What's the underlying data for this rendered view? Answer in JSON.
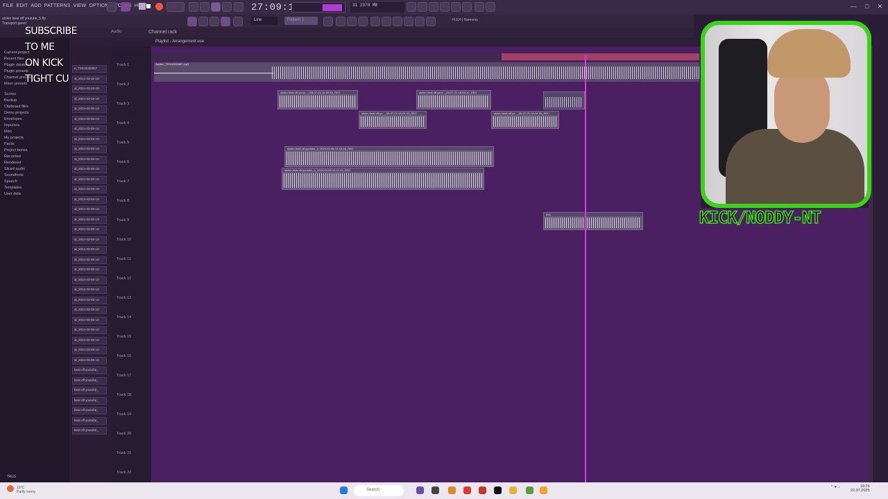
{
  "app": {
    "menu": [
      "FILE",
      "EDIT",
      "ADD",
      "PATTERNS",
      "VIEW",
      "OPTIONS",
      "TOOLS",
      "HELP"
    ],
    "time_display": "27:09:16",
    "cpu_ram": "2378 MB",
    "cpu_num": "31",
    "file_name": "stolen beat off youtube_5.flp",
    "transport_hint": "Transport panel",
    "snap_mode": "Line",
    "pattern_label": "Pattern 1",
    "plugin_label": "FLEX | Harmony",
    "colors": {
      "accent": "#b23bd8",
      "record": "#ef5a3b",
      "playhead": "#d93cd8",
      "cam_border": "#39d416"
    }
  },
  "tabs": {
    "audio": "Audio",
    "channel_rack": "Channel rack"
  },
  "playlist": {
    "title": "Playlist",
    "arrangement": "Arrangement",
    "sub": "use",
    "tracks": [
      "Track 1",
      "Track 2",
      "Track 3",
      "Track 4",
      "Track 5",
      "Track 6",
      "Track 7",
      "Track 8",
      "Track 9",
      "Track 10",
      "Track 11",
      "Track 12",
      "Track 13",
      "Track 14",
      "Track 15",
      "Track 16",
      "Track 17",
      "Track 18",
      "Track 19",
      "Track 20",
      "Track 21",
      "Track 22"
    ],
    "clips": [
      {
        "label": "stolen beat off youtu..._3/5-07-21-16-59-54_REC"
      },
      {
        "label": "stolen beat off yout..._25-07-21-16-02-10_REC"
      },
      {
        "label": "stolen beat off yo..._05-07-21-16-01-43_REC"
      },
      {
        "label": "stolen beat off yo..._05-07-21-16-04-08_REC"
      },
      {
        "label": "stolen beat off youtube_2_2024-03-08-14-18-48_REC"
      },
      {
        "label": "stolen beat off youtube_2_2024-03-08-14-11-41_REC"
      },
      {
        "label": "kick"
      },
      {
        "label": "Jupiter_TX515332867.mp3"
      }
    ]
  },
  "browser": {
    "items": [
      "Current project",
      "Recent files",
      "Plugin database",
      "Plugin presets",
      "Channel presets",
      "Mixer presets",
      "Scores",
      "Backup",
      "Clipboard files",
      "Demo projects",
      "Envelopes",
      "Impulses",
      "Misc",
      "My projects",
      "Packs",
      "Project bones",
      "Recorded",
      "Rendered",
      "Sliced audio",
      "Soundfonts",
      "Speech",
      "Templates",
      "User data"
    ],
    "tags": "TAGS"
  },
  "patterns": [
    "e_TX515332867",
    "al_2024-03-18-10-",
    "al_2024-03-18-10-",
    "al_2024-03-18-10-",
    "al_2024-03-08-13-",
    "al_2024-03-08-13-",
    "al_2024-03-08-13-",
    "al_2024-03-08-13-",
    "al_2024-03-08-13-",
    "al_2024-03-08-13-",
    "al_2024-03-08-13-",
    "al_2024-03-08-13-",
    "al_2024-03-08-13-",
    "al_2024-03-08-13-",
    "al_2024-03-08-13-",
    "al_2024-03-08-13-",
    "al_2024-03-08-12-",
    "al_2024-03-08-12-",
    "al_2024-03-08-12-",
    "al_2024-03-08-12-",
    "al_2024-03-08-12-",
    "al_2024-03-08-12-",
    "al_2024-03-08-12-",
    "al_2024-03-08-12-",
    "al_2024-03-08-12-",
    "al_2024-03-08-12-",
    "al_2024-03-08-12-",
    "al_2024-03-08-12-",
    "al_2024-03-08-12-",
    "al_2024-03-08-12-",
    "beat off youtube_",
    "beat off youtube_",
    "beat off youtube_",
    "beat off youtube_",
    "beat off youtube_",
    "beat off youtube_",
    "beat off youtube_"
  ],
  "overlay": {
    "line1": "SUBSCRIBE",
    "line2": "TO ME",
    "line3": "ON KICK",
    "line4": "TIGHT CUNTS",
    "channel_name": "KICK/NODDY-NT"
  },
  "taskbar": {
    "weather_temp": "19°C",
    "weather_desc": "Partly sunny",
    "search": "Search",
    "time": "18:25",
    "date": "22.07.2025"
  }
}
